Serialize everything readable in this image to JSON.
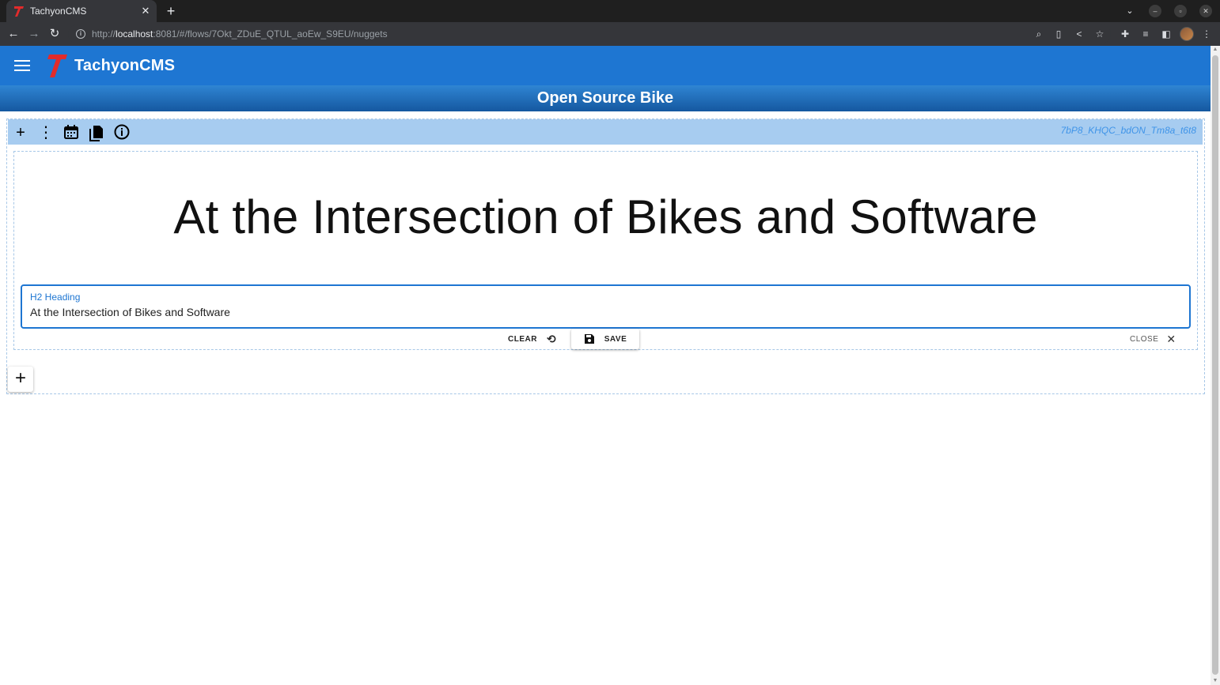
{
  "browser": {
    "tab_title": "TachyonCMS",
    "url_scheme": "http://",
    "url_host": "localhost",
    "url_path": ":8081/#/flows/7Okt_ZDuE_QTUL_aoEw_S9EU/nuggets"
  },
  "app": {
    "title": "TachyonCMS",
    "brand_color": "#1e76d2",
    "logo_letter": "T"
  },
  "flow": {
    "title": "Open Source Bike"
  },
  "nugget": {
    "id": "7bP8_KHQC_bdON_Tm8a_t6t8",
    "heading_preview": "At the Intersection of Bikes and Software",
    "field_label": "H2 Heading",
    "field_value": "At the Intersection of Bikes and Software"
  },
  "actions": {
    "clear_label": "CLEAR",
    "save_label": "SAVE",
    "close_label": "CLOSE"
  }
}
